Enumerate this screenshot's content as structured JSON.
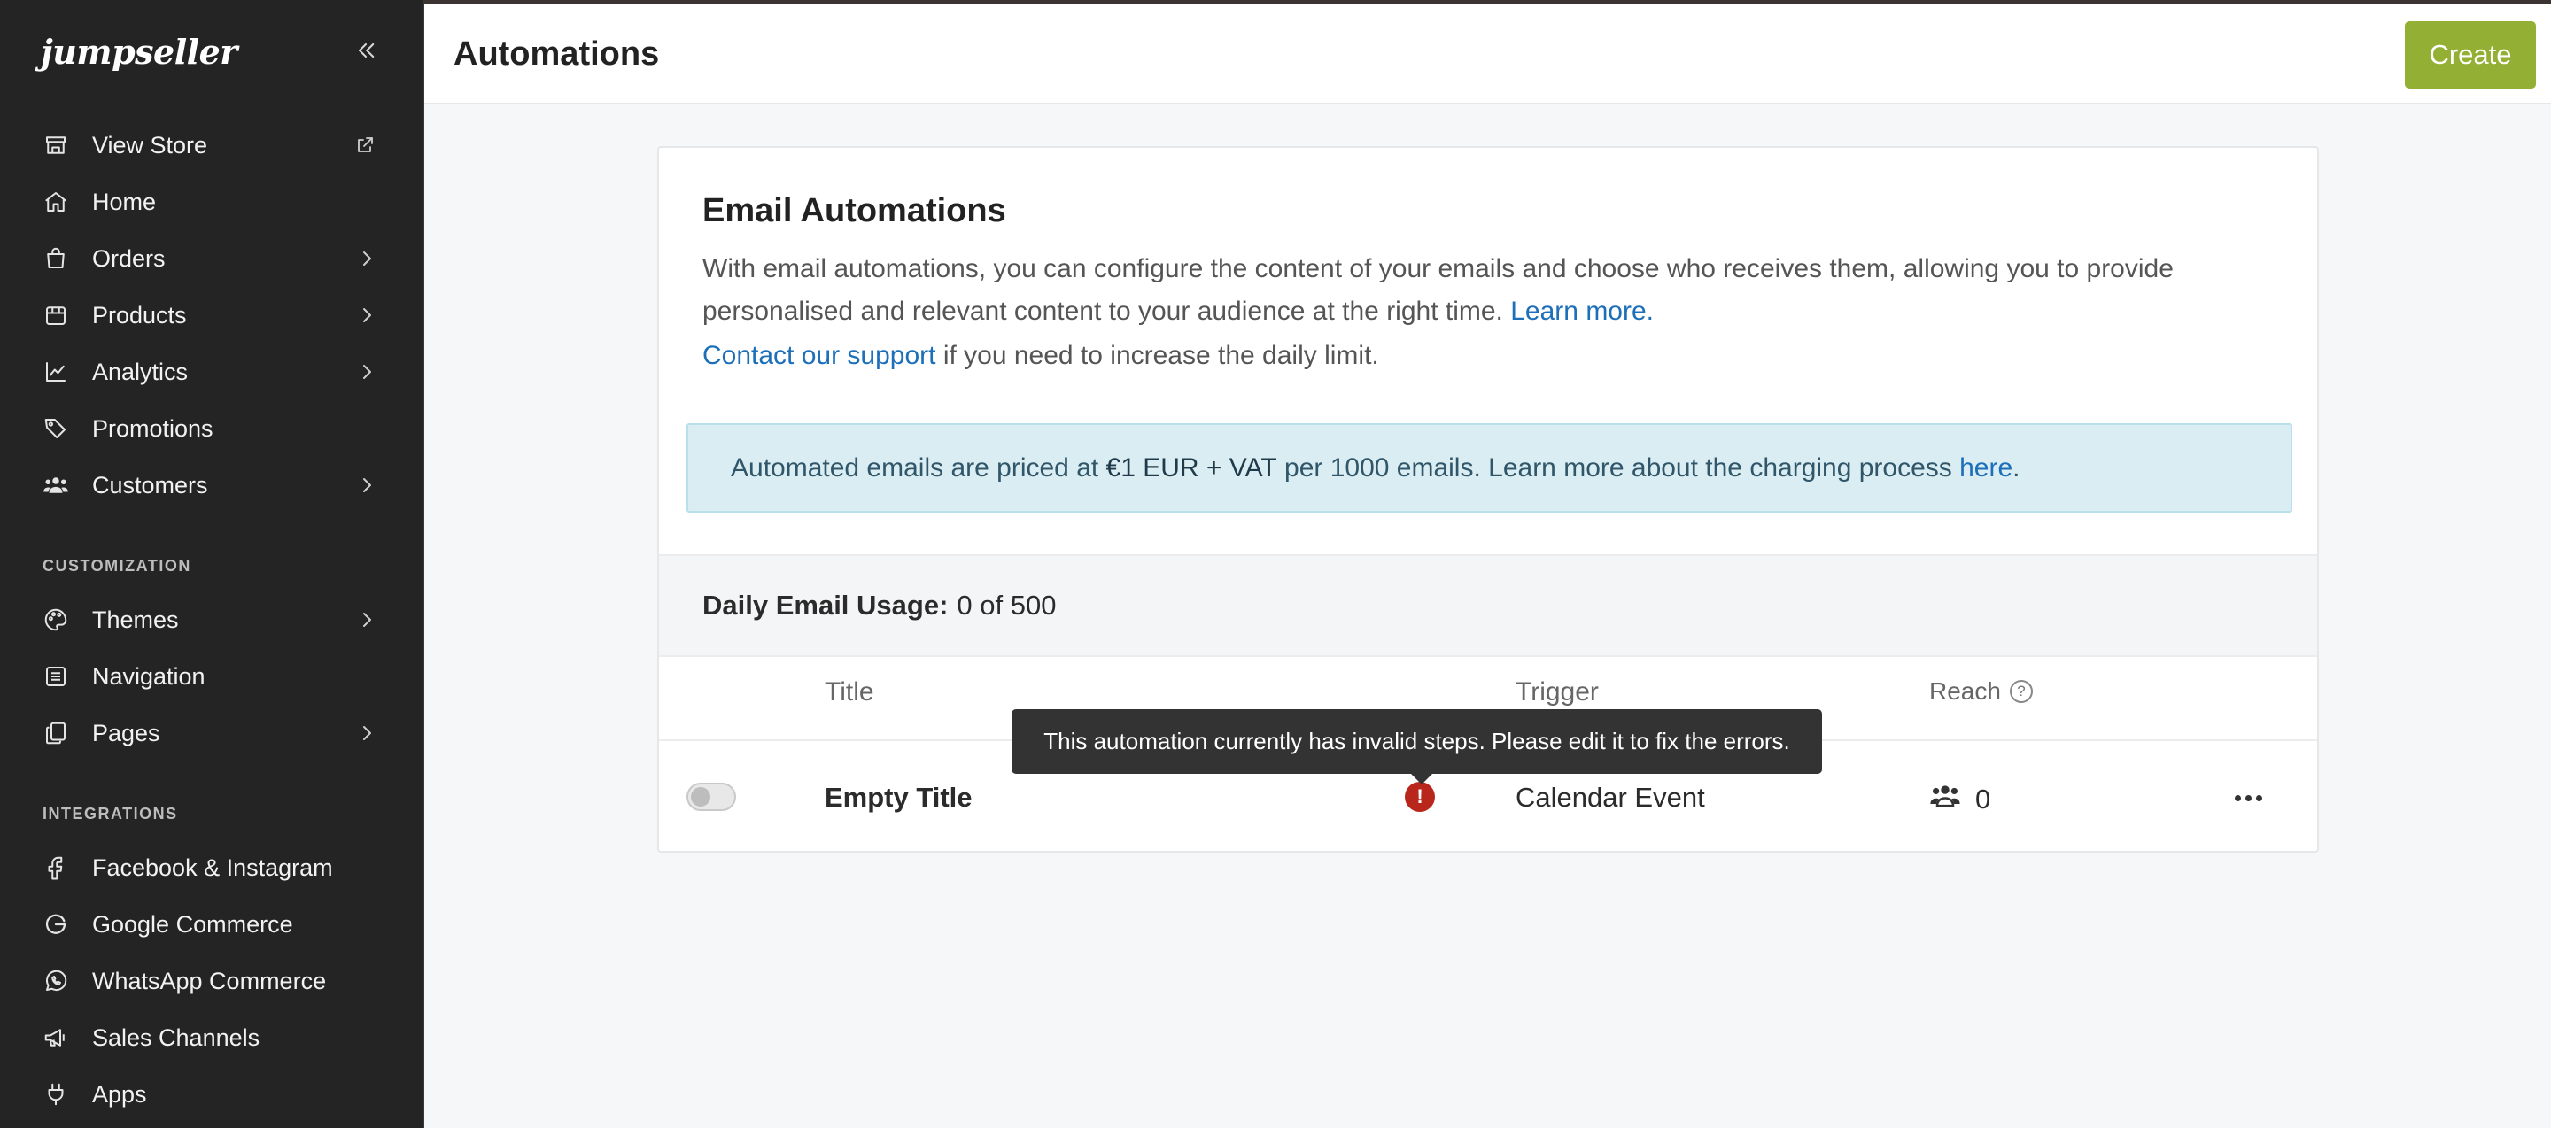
{
  "sidebar": {
    "logo": "jumpseller",
    "main_items": [
      {
        "label": "View Store",
        "icon": "store-icon",
        "external": true
      },
      {
        "label": "Home",
        "icon": "home-icon"
      },
      {
        "label": "Orders",
        "icon": "shopping-bag-icon",
        "has_submenu": true
      },
      {
        "label": "Products",
        "icon": "box-icon",
        "has_submenu": true
      },
      {
        "label": "Analytics",
        "icon": "chart-line-icon",
        "has_submenu": true
      },
      {
        "label": "Promotions",
        "icon": "tag-icon"
      },
      {
        "label": "Customers",
        "icon": "users-icon",
        "has_submenu": true
      }
    ],
    "customization_label": "CUSTOMIZATION",
    "customization_items": [
      {
        "label": "Themes",
        "icon": "palette-icon",
        "has_submenu": true
      },
      {
        "label": "Navigation",
        "icon": "list-icon"
      },
      {
        "label": "Pages",
        "icon": "pages-icon",
        "has_submenu": true
      }
    ],
    "integrations_label": "INTEGRATIONS",
    "integrations_items": [
      {
        "label": "Facebook & Instagram",
        "icon": "facebook-icon"
      },
      {
        "label": "Google Commerce",
        "icon": "google-icon"
      },
      {
        "label": "WhatsApp Commerce",
        "icon": "whatsapp-icon"
      },
      {
        "label": "Sales Channels",
        "icon": "megaphone-icon"
      },
      {
        "label": "Apps",
        "icon": "plug-icon"
      }
    ]
  },
  "header": {
    "title": "Automations",
    "create_label": "Create"
  },
  "card": {
    "title": "Email Automations",
    "description": "With email automations, you can configure the content of your emails and choose who receives them, allowing you to provide personalised and relevant content to your audience at the right time.",
    "learn_more": "Learn more.",
    "support_link": "Contact our support",
    "support_text": " if you need to increase the daily limit.",
    "info_prefix": "Automated emails are priced at ",
    "info_price": "€1 EUR + VAT",
    "info_middle": " per 1000 emails. Learn more about the charging process ",
    "info_link": "here",
    "info_suffix": ".",
    "usage_label": "Daily Email Usage:",
    "usage_value": "0 of 500"
  },
  "table": {
    "headers": {
      "title": "Title",
      "trigger": "Trigger",
      "reach": "Reach"
    },
    "help_symbol": "?",
    "rows": [
      {
        "enabled": false,
        "title": "Empty Title",
        "has_error": true,
        "error_symbol": "!",
        "trigger": "Calendar Event",
        "reach": "0"
      }
    ]
  },
  "tooltip": {
    "text": "This automation currently has invalid steps. Please edit it to fix the errors."
  },
  "colors": {
    "sidebar_bg": "#242424",
    "accent": "#93b034",
    "link": "#1c6fb8",
    "error": "#b8261c",
    "info_bg": "#d9edf2"
  }
}
